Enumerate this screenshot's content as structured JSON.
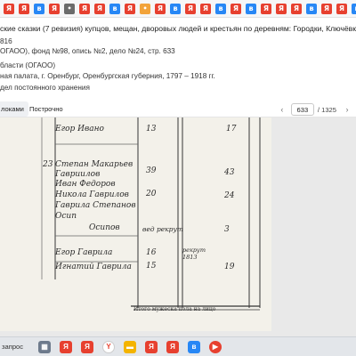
{
  "header": {
    "title": "ские сказки (7 ревизия) купцов, мещан, дворовых людей и крестьян по деревням: Городки, Ключёвка, Козловка, Там",
    "line1": "816",
    "line2": "ОГАОО), фонд №98, опись №2, дело №24, стр. 633",
    "line3": "бласти (ОГАОО)",
    "line4": "ная палата, г. Оренбург, Оренбургская губерния, 1797 – 1918 гг.",
    "line5": "дел постоянного хранения"
  },
  "tabs": [
    {
      "label": "локами",
      "active": true
    },
    {
      "label": "Построчно",
      "active": false
    }
  ],
  "pager": {
    "current": "633",
    "separator": "/ 1325"
  },
  "document": {
    "rows": [
      {
        "num": "",
        "name": "Егор    Ивано",
        "left": "13",
        "right": "17"
      },
      {
        "num": "23",
        "name": "Степан  Макарьев",
        "left": "39",
        "right": "43"
      },
      {
        "num": "",
        "name": "Гавриилов",
        "left": "",
        "right": ""
      },
      {
        "num": "",
        "name": "Иван  Федоров",
        "left": "",
        "right": ""
      },
      {
        "num": "",
        "name": "Никола  Гаврилов",
        "left": "20",
        "right": "24"
      },
      {
        "num": "",
        "name": "Гаврила  Степанов",
        "left": "",
        "right": ""
      },
      {
        "num": "",
        "name": "Осип",
        "left": "",
        "right": ""
      },
      {
        "num": "",
        "name": "Осипов",
        "left": "вед рекрут",
        "right": "3"
      },
      {
        "num": "",
        "name": "Егор   Гаврила",
        "left": "16",
        "right": ""
      },
      {
        "num": "",
        "name": "Игнатий  Гаврила",
        "left": "15",
        "right": "19"
      }
    ],
    "note": "рекрут 1813",
    "footer": "Итого мужеска пола на лицо"
  },
  "taskbar": {
    "search": "запрос"
  },
  "colors": {
    "yandex": "#e7402f",
    "vk": "#2787f5",
    "tab_active": "#eef0f3"
  }
}
